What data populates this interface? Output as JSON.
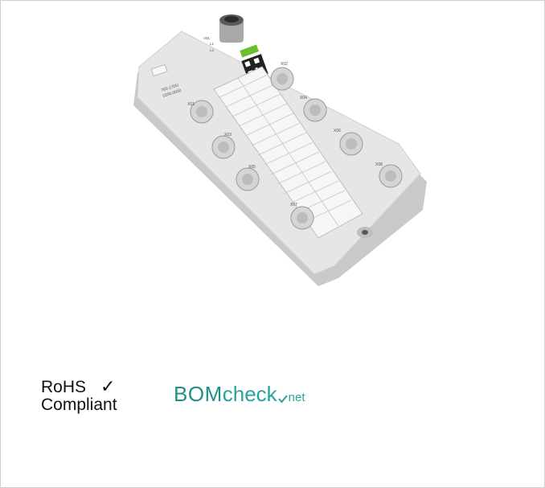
{
  "product": {
    "model_number": "765-1705/",
    "model_variant": "0200-0000",
    "port_labels": [
      "X01",
      "X02",
      "X03",
      "X04",
      "X05",
      "X06",
      "X07",
      "X08"
    ],
    "indicators": [
      "VDL",
      "L1",
      "L2"
    ]
  },
  "badges": {
    "rohs_line1": "RoHS",
    "rohs_check": "✓",
    "rohs_line2": "Compliant",
    "bom_main": "BOM",
    "bom_secondary": "check",
    "bom_suffix": "net"
  },
  "colors": {
    "housing": "#e3e3e3",
    "housing_shadow": "#bdbdbd",
    "brand_green": "#6cbf2c",
    "bomcheck_teal": "#1f8f8a"
  }
}
